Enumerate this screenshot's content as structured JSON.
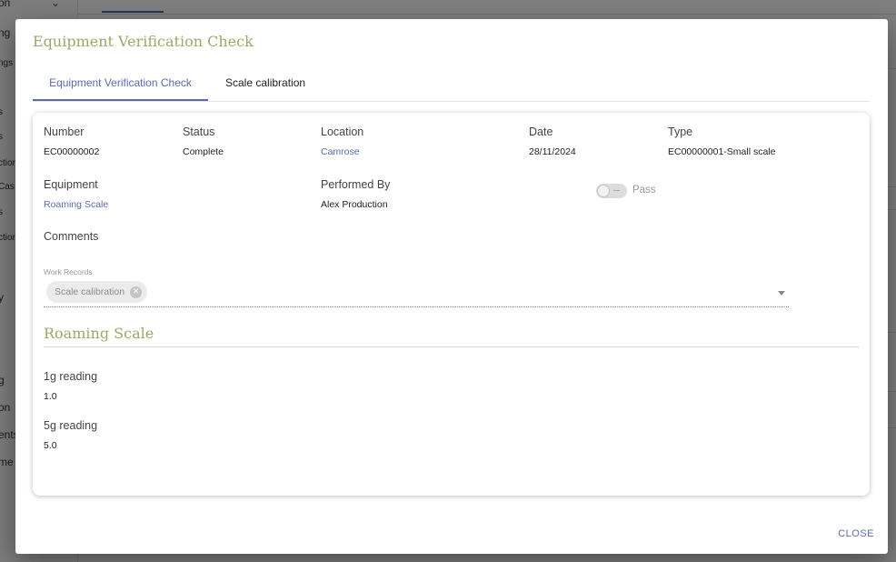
{
  "background": {
    "sidebar_items": [
      "on",
      "ng",
      "ngs",
      "s",
      "s",
      "ction",
      "Cas",
      "s",
      "ction",
      "y",
      "g",
      "on",
      "ents",
      "me"
    ]
  },
  "dialog": {
    "title": "Equipment Verification Check",
    "tabs": [
      "Equipment Verification Check",
      "Scale calibration"
    ],
    "fields": {
      "number_label": "Number",
      "number_value": "EC00000002",
      "status_label": "Status",
      "status_value": "Complete",
      "location_label": "Location",
      "location_value": "Camrose",
      "date_label": "Date",
      "date_value": "28/11/2024",
      "type_label": "Type",
      "type_value": "EC00000001-Small scale",
      "equipment_label": "Equipment",
      "equipment_value": "Roaming Scale",
      "performed_by_label": "Performed By",
      "performed_by_value": "Alex Production",
      "pass_label": "Pass",
      "comments_label": "Comments"
    },
    "work_records": {
      "label": "Work Records",
      "chips": [
        "Scale calibration"
      ]
    },
    "section": {
      "title": "Roaming Scale",
      "readings": [
        {
          "label": "1g reading",
          "value": "1.0"
        },
        {
          "label": "5g reading",
          "value": "5.0"
        }
      ]
    },
    "close_label": "CLOSE"
  },
  "colors": {
    "accent": "#5b6bb0",
    "title_olive": "#9ea76a"
  },
  "toggle_pass": false
}
